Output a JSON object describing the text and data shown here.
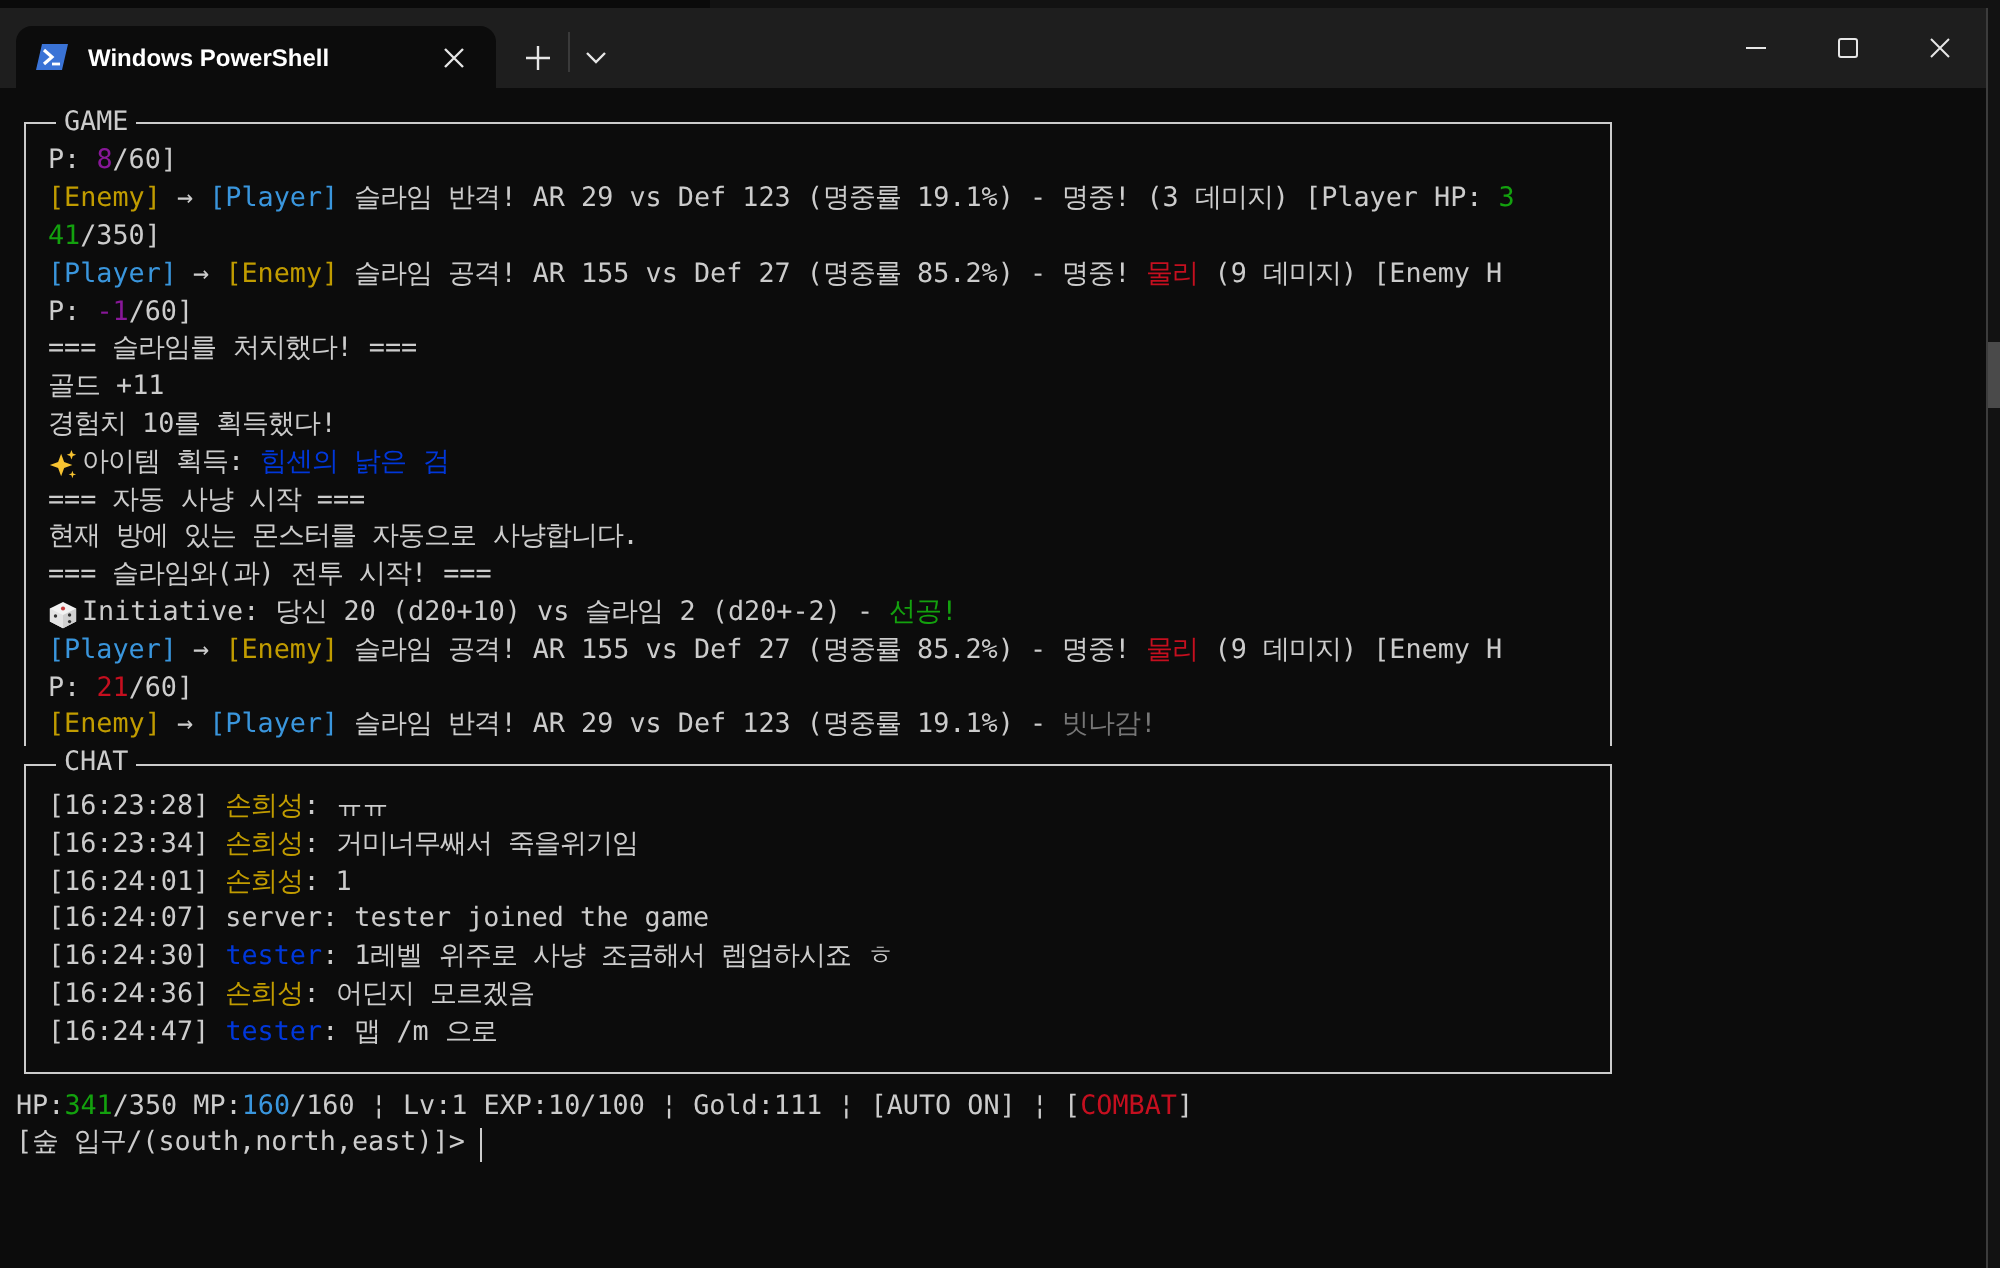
{
  "window": {
    "tab": {
      "title": "Windows PowerShell",
      "selected": true
    }
  },
  "game": {
    "title": "GAME",
    "lines": [
      {
        "kind": "text",
        "segments": [
          {
            "text": "P: "
          },
          {
            "text": "8",
            "color": "#881798"
          },
          {
            "text": "/60]"
          }
        ]
      },
      {
        "kind": "text",
        "segments": [
          {
            "text": "[Enemy]",
            "color": "#c19c00"
          },
          {
            "text": " → "
          },
          {
            "text": "[Player]",
            "color": "#3a96dd"
          },
          {
            "text": " 슬라임 반격! AR 29 vs Def 123 (명중률 19.1%) - 명중! (3 데미지) [Player HP: "
          },
          {
            "text": "3",
            "color": "#13a10e"
          }
        ]
      },
      {
        "kind": "text",
        "segments": [
          {
            "text": "41",
            "color": "#13a10e"
          },
          {
            "text": "/350]"
          }
        ]
      },
      {
        "kind": "text",
        "segments": [
          {
            "text": "[Player]",
            "color": "#3a96dd"
          },
          {
            "text": " → "
          },
          {
            "text": "[Enemy]",
            "color": "#c19c00"
          },
          {
            "text": " 슬라임 공격! AR 155 vs Def 27 (명중률 85.2%) - 명중! "
          },
          {
            "text": "물리",
            "color": "#c50f1f"
          },
          {
            "text": " (9 데미지) [Enemy H"
          }
        ]
      },
      {
        "kind": "text",
        "segments": [
          {
            "text": "P: "
          },
          {
            "text": "-1",
            "color": "#881798"
          },
          {
            "text": "/60]"
          }
        ]
      },
      {
        "kind": "text",
        "segments": [
          {
            "text": "=== 슬라임를 처치했다! ==="
          }
        ]
      },
      {
        "kind": "text",
        "segments": [
          {
            "text": "골드 +11"
          }
        ]
      },
      {
        "kind": "text",
        "segments": [
          {
            "text": "경험치 10를 획득했다!"
          }
        ]
      },
      {
        "kind": "loot",
        "segments": [
          {
            "text": "아이템 획득: "
          },
          {
            "text": "힘센의 낡은 검",
            "color": "#0037da"
          }
        ]
      },
      {
        "kind": "text",
        "segments": [
          {
            "text": "=== 자동 사냥 시작 ==="
          }
        ]
      },
      {
        "kind": "text",
        "segments": [
          {
            "text": "현재 방에 있는 몬스터를 자동으로 사냥합니다."
          }
        ]
      },
      {
        "kind": "text",
        "segments": [
          {
            "text": "=== 슬라임와(과) 전투 시작! ==="
          }
        ]
      },
      {
        "kind": "roll",
        "segments": [
          {
            "text": "Initiative: 당신 20 (d20+10) vs 슬라임 2 (d20+-2) - "
          },
          {
            "text": "선공!",
            "color": "#13a10e"
          }
        ]
      },
      {
        "kind": "text",
        "segments": [
          {
            "text": "[Player]",
            "color": "#3a96dd"
          },
          {
            "text": " → "
          },
          {
            "text": "[Enemy]",
            "color": "#c19c00"
          },
          {
            "text": " 슬라임 공격! AR 155 vs Def 27 (명중률 85.2%) - 명중! "
          },
          {
            "text": "물리",
            "color": "#c50f1f"
          },
          {
            "text": " (9 데미지) [Enemy H"
          }
        ]
      },
      {
        "kind": "text",
        "segments": [
          {
            "text": "P: "
          },
          {
            "text": "21",
            "color": "#c50f1f"
          },
          {
            "text": "/60]"
          }
        ]
      },
      {
        "kind": "text",
        "segments": [
          {
            "text": "[Enemy]",
            "color": "#c19c00"
          },
          {
            "text": " → "
          },
          {
            "text": "[Player]",
            "color": "#3a96dd"
          },
          {
            "text": " 슬라임 반격! AR 29 vs Def 123 (명중률 19.1%) - "
          },
          {
            "text": "빗나감!",
            "color": "#767676"
          }
        ]
      }
    ]
  },
  "chat": {
    "title": "CHAT",
    "lines": [
      {
        "segments": [
          {
            "text": "[16:23:28] "
          },
          {
            "text": "손희성",
            "color": "#c19c00"
          },
          {
            "text": ": ㅠㅠ"
          }
        ]
      },
      {
        "segments": [
          {
            "text": "[16:23:34] "
          },
          {
            "text": "손희성",
            "color": "#c19c00"
          },
          {
            "text": ": 거미너무쌔서 죽을위기임"
          }
        ]
      },
      {
        "segments": [
          {
            "text": "[16:24:01] "
          },
          {
            "text": "손희성",
            "color": "#c19c00"
          },
          {
            "text": ": 1"
          }
        ]
      },
      {
        "segments": [
          {
            "text": "[16:24:07] server: tester joined the game"
          }
        ]
      },
      {
        "segments": [
          {
            "text": "[16:24:30] "
          },
          {
            "text": "tester",
            "color": "#0037da"
          },
          {
            "text": ": 1레벨 위주로 사냥 조금해서 렙업하시죠 ㅎ"
          }
        ]
      },
      {
        "segments": [
          {
            "text": "[16:24:36] "
          },
          {
            "text": "손희성",
            "color": "#c19c00"
          },
          {
            "text": ": 어딘지 모르겠음"
          }
        ]
      },
      {
        "segments": [
          {
            "text": "[16:24:47] "
          },
          {
            "text": "tester",
            "color": "#0037da"
          },
          {
            "text": ": 맵 /m 으로"
          }
        ]
      }
    ]
  },
  "status": {
    "segments": [
      {
        "text": "HP:"
      },
      {
        "text": "341",
        "color": "#13a10e"
      },
      {
        "text": "/350 MP:"
      },
      {
        "text": "160",
        "color": "#3a96dd"
      },
      {
        "text": "/160 ¦ Lv:1 EXP:10/100 ¦ Gold:111 ¦ [AUTO ON] ¦ ["
      },
      {
        "text": "COMBAT",
        "color": "#c50f1f"
      },
      {
        "text": "]"
      }
    ]
  },
  "prompt": {
    "text": "[숲 입구/(south,north,east)]>"
  }
}
